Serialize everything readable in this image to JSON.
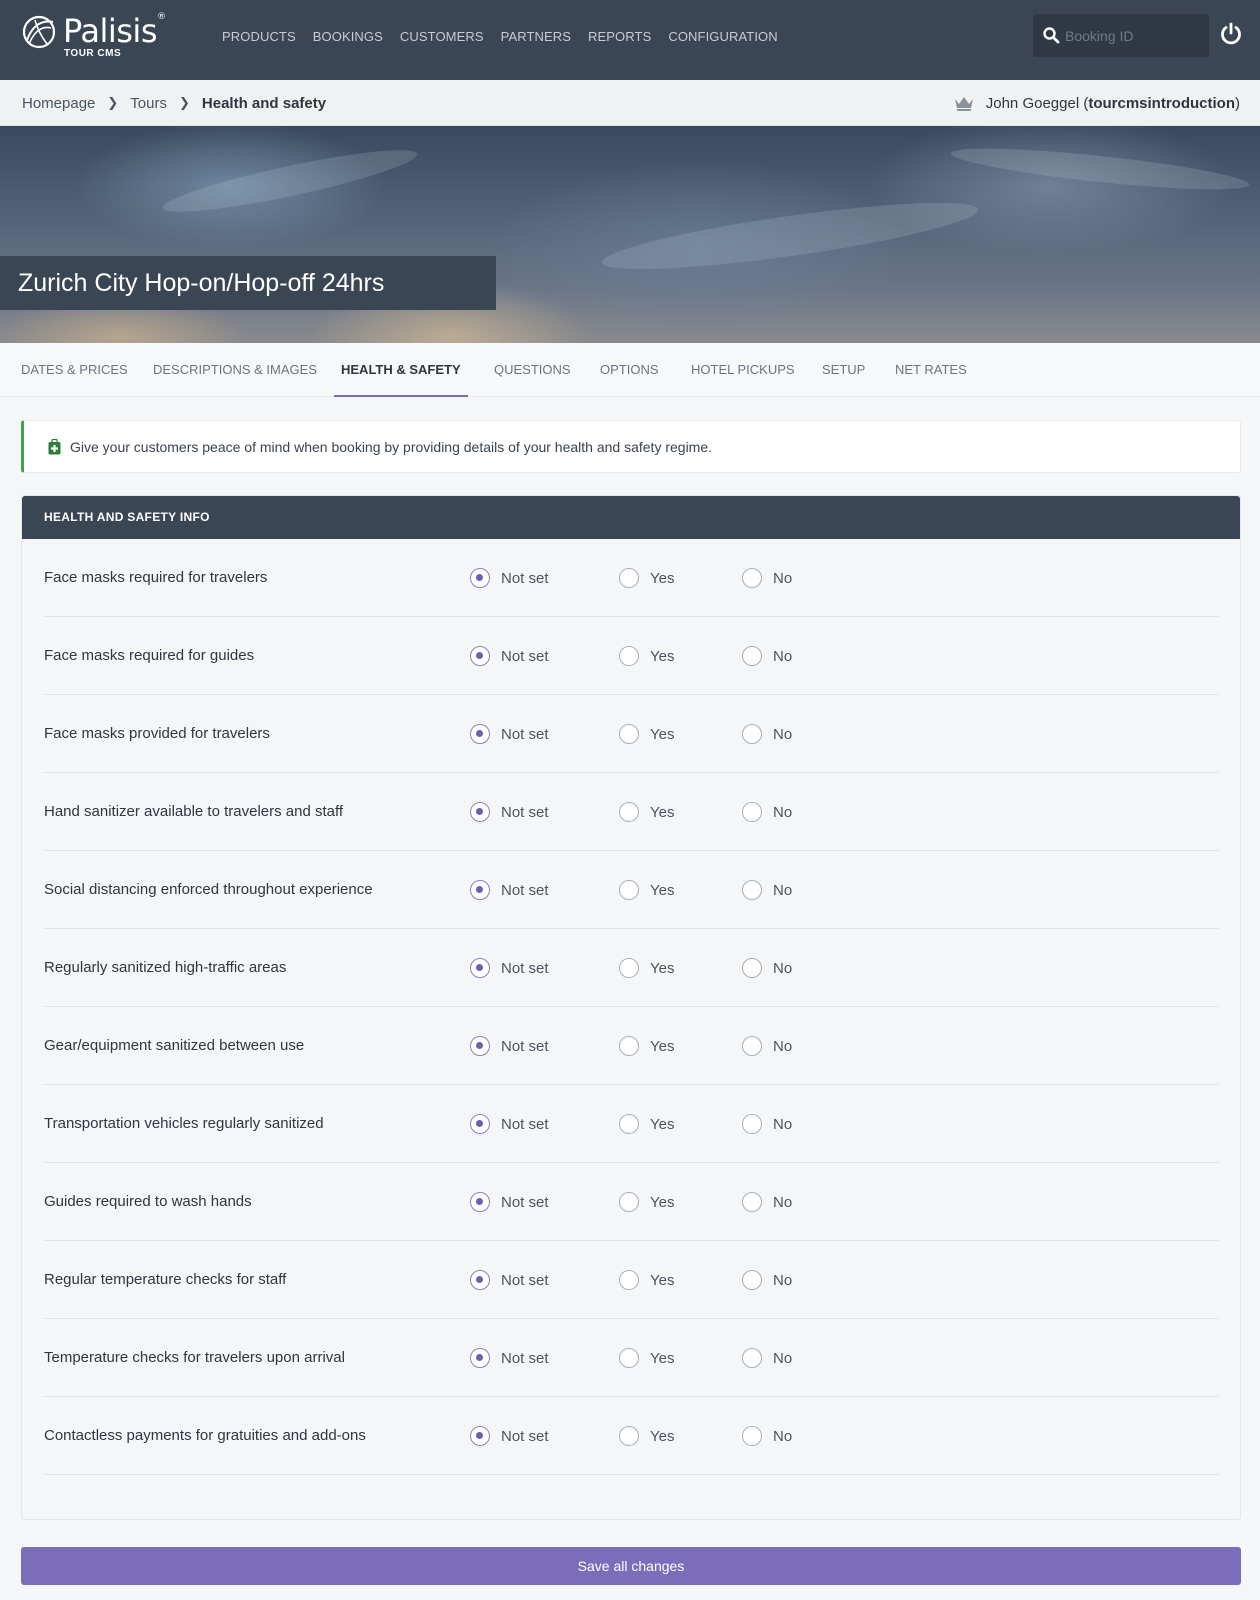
{
  "brand": {
    "name": "Palisis",
    "trademark": "®",
    "subtitle": "TOUR CMS"
  },
  "nav": [
    "PRODUCTS",
    "BOOKINGS",
    "CUSTOMERS",
    "PARTNERS",
    "REPORTS",
    "CONFIGURATION"
  ],
  "search": {
    "placeholder": "Booking ID",
    "value": ""
  },
  "breadcrumb": {
    "home": "Homepage",
    "section": "Tours",
    "current": "Health and safety"
  },
  "user": {
    "name": "John Goeggel",
    "account": "tourcmsintroduction",
    "open": "(",
    "close": ")"
  },
  "hero": {
    "title": "Zurich City Hop-on/Hop-off 24hrs"
  },
  "tabs": [
    "DATES & PRICES",
    "DESCRIPTIONS & IMAGES",
    "HEALTH & SAFETY",
    "QUESTIONS",
    "OPTIONS",
    "HOTEL PICKUPS",
    "SETUP",
    "NET RATES"
  ],
  "active_tab": "HEALTH & SAFETY",
  "callout": {
    "text": "Give your customers peace of mind when booking by providing details of your health and safety regime."
  },
  "panel": {
    "title": "HEALTH AND SAFETY INFO",
    "options": [
      "Not set",
      "Yes",
      "No"
    ],
    "rows": [
      {
        "label": "Face masks required for travelers",
        "selected": "Not set"
      },
      {
        "label": "Face masks required for guides",
        "selected": "Not set"
      },
      {
        "label": "Face masks provided for travelers",
        "selected": "Not set"
      },
      {
        "label": "Hand sanitizer available to travelers and staff",
        "selected": "Not set"
      },
      {
        "label": "Social distancing enforced throughout experience",
        "selected": "Not set"
      },
      {
        "label": "Regularly sanitized high-traffic areas",
        "selected": "Not set"
      },
      {
        "label": "Gear/equipment sanitized between use",
        "selected": "Not set"
      },
      {
        "label": "Transportation vehicles regularly sanitized",
        "selected": "Not set"
      },
      {
        "label": "Guides required to wash hands",
        "selected": "Not set"
      },
      {
        "label": "Regular temperature checks for staff",
        "selected": "Not set"
      },
      {
        "label": "Temperature checks for travelers upon arrival",
        "selected": "Not set"
      },
      {
        "label": "Contactless payments for gratuities and add-ons",
        "selected": "Not set"
      }
    ]
  },
  "save_label": "Save all changes",
  "colors": {
    "header": "#3b4654",
    "accent": "#7b6dba",
    "success": "#3fa34d"
  }
}
